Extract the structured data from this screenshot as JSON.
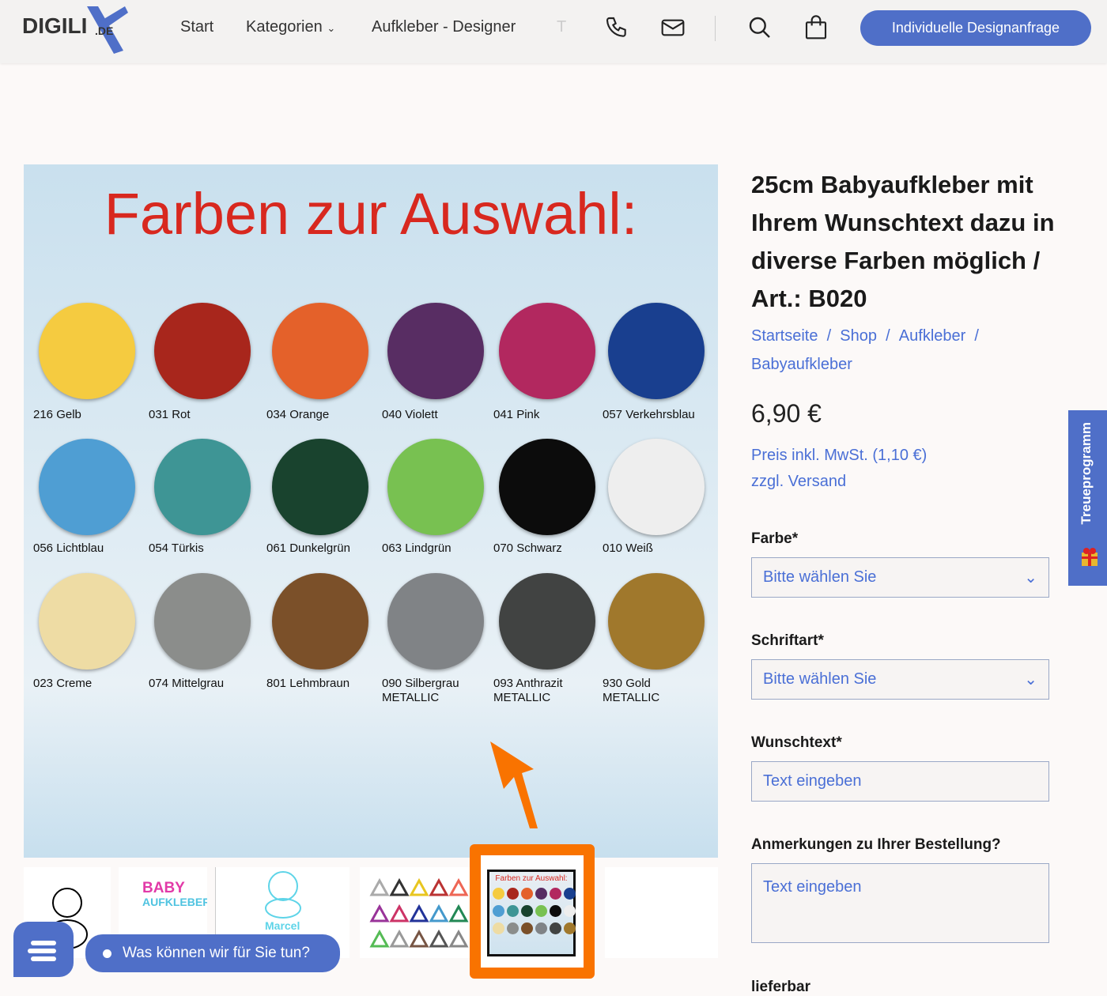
{
  "header": {
    "logo": "DIGILIX.DE",
    "nav": [
      "Start",
      "Kategorien",
      "Aufkleber - Designer",
      "T"
    ],
    "cta": "Individuelle Designanfrage"
  },
  "gallery": {
    "title": "Farben zur Auswahl:",
    "swatches": [
      {
        "label": "216 Gelb",
        "color": "#f5cb40"
      },
      {
        "label": "031 Rot",
        "color": "#a8261c"
      },
      {
        "label": "034 Orange",
        "color": "#e4612a"
      },
      {
        "label": "040 Violett",
        "color": "#582d63"
      },
      {
        "label": "041 Pink",
        "color": "#b2285f"
      },
      {
        "label": "057 Verkehrsblau",
        "color": "#193f8f"
      },
      {
        "label": "056 Lichtblau",
        "color": "#4f9ed3"
      },
      {
        "label": "054 Türkis",
        "color": "#3e9595"
      },
      {
        "label": "061 Dunkelgrün",
        "color": "#19432e"
      },
      {
        "label": "063 Lindgrün",
        "color": "#78c151"
      },
      {
        "label": "070 Schwarz",
        "color": "#0c0c0c"
      },
      {
        "label": "010 Weiß",
        "color": "#eeeeee"
      },
      {
        "label": "023 Creme",
        "color": "#eedca4"
      },
      {
        "label": "074 Mittelgrau",
        "color": "#8b8d8b"
      },
      {
        "label": "801 Lehmbraun",
        "color": "#7b5029"
      },
      {
        "label": "090 Silbergrau\nMETALLIC",
        "color": "#808386"
      },
      {
        "label": "093 Anthrazit\nMETALLIC",
        "color": "#414342"
      },
      {
        "label": "930 Gold\nMETALLIC",
        "color": "#a0782c"
      }
    ]
  },
  "thumbs": {
    "baby": "BABY",
    "aufkleber": "AUFKLEBER",
    "name": "Marcel",
    "mini_title": "Farben zur Auswahl:"
  },
  "chat": {
    "message": "Was können wir für Sie tun?"
  },
  "product": {
    "title": "25cm Babyaufkleber mit Ihrem Wunschtext dazu in diverse Farben möglich / Art.: B020",
    "breadcrumb": [
      "Startseite",
      "Shop",
      "Aufkleber",
      "Babyaufkleber"
    ],
    "price": "6,90 €",
    "tax": "Preis inkl. MwSt. (1,10 €)",
    "shipping": "zzgl. Versand",
    "farbe_label": "Farbe*",
    "farbe_value": "Bitte wählen Sie",
    "schrift_label": "Schriftart*",
    "schrift_value": "Bitte wählen Sie",
    "wunsch_label": "Wunschtext*",
    "wunsch_placeholder": "Text eingeben",
    "anm_label": "Anmerkungen zu Ihrer Bestellung?",
    "anm_placeholder": "Text eingeben",
    "stock": "lieferbar"
  },
  "side_tab": "Treueprogramm",
  "colors": {
    "accent": "#4f6fc8",
    "link": "#4a6fd6",
    "highlight": "#f97300"
  }
}
